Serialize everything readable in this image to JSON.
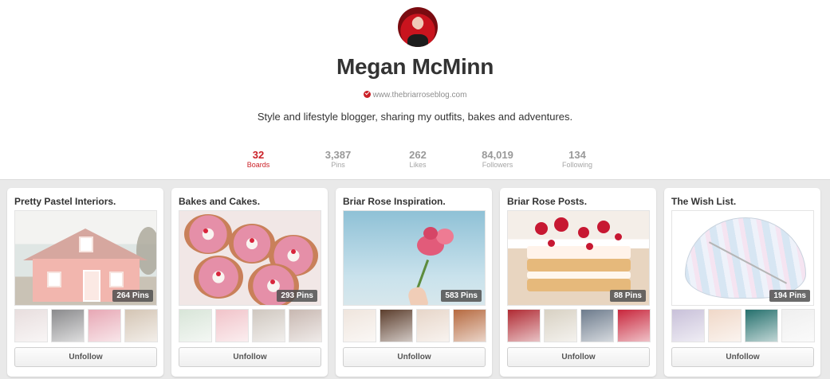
{
  "profile": {
    "name": "Megan McMinn",
    "website": "www.thebriarroseblog.com",
    "bio": "Style and lifestyle blogger, sharing my outfits, bakes and adventures."
  },
  "stats": [
    {
      "value": "32",
      "label": "Boards",
      "active": true
    },
    {
      "value": "3,387",
      "label": "Pins",
      "active": false
    },
    {
      "value": "262",
      "label": "Likes",
      "active": false
    },
    {
      "value": "84,019",
      "label": "Followers",
      "active": false
    },
    {
      "value": "134",
      "label": "Following",
      "active": false
    }
  ],
  "boards": [
    {
      "title": "Pretty Pastel Interiors.",
      "pin_count": "264 Pins",
      "button": "Unfollow",
      "thumb_colors": [
        "#e8dede",
        "#8a8a8c",
        "#e7a7b4",
        "#d4c5b4"
      ]
    },
    {
      "title": "Bakes and Cakes.",
      "pin_count": "293 Pins",
      "button": "Unfollow",
      "thumb_colors": [
        "#d8e5d8",
        "#f1c3c9",
        "#cfc7bf",
        "#c8b8b1"
      ]
    },
    {
      "title": "Briar Rose Inspiration.",
      "pin_count": "583 Pins",
      "button": "Unfollow",
      "thumb_colors": [
        "#efe5dd",
        "#5c3e2d",
        "#e7d6c9",
        "#b66a40"
      ]
    },
    {
      "title": "Briar Rose Posts.",
      "pin_count": "88 Pins",
      "button": "Unfollow",
      "thumb_colors": [
        "#b02a33",
        "#d8d1c3",
        "#6d7b8c",
        "#c8263c"
      ]
    },
    {
      "title": "The Wish List.",
      "pin_count": "194 Pins",
      "button": "Unfollow",
      "thumb_colors": [
        "#c8c0d9",
        "#f0d8c8",
        "#25706d",
        "#efefef"
      ]
    }
  ],
  "colors": {
    "accent": "#cb2027",
    "board_bg": "#e9e9e9"
  }
}
